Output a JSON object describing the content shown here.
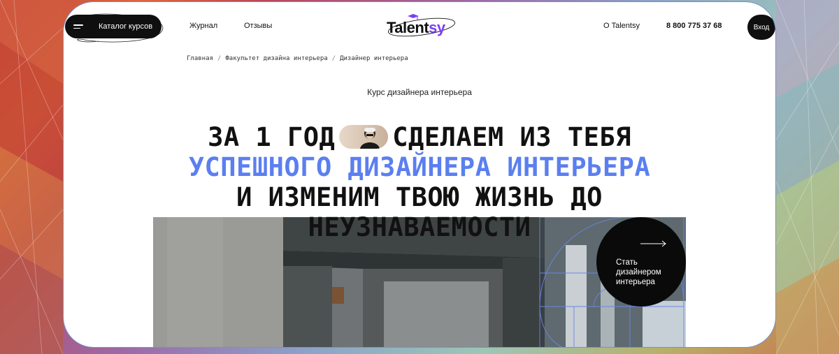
{
  "header": {
    "catalog_label": "Каталог курсов",
    "nav": [
      "Журнал",
      "Отзывы"
    ],
    "logo_main": "Talent",
    "logo_accent": "sy",
    "about_label": "О Talentsy",
    "phone": "8 800 775 37 68",
    "login_label": "Вход"
  },
  "breadcrumb": [
    "Главная",
    "Факультет дизайна интерьера",
    "Дизайнер интерьера"
  ],
  "subtitle": "Курс дизайнера интерьера",
  "hero": {
    "line1_a": "ЗА 1 ГОД",
    "line1_b": "СДЕЛАЕМ ИЗ ТЕБЯ",
    "line2": "УСПЕШНОГО ДИЗАЙНЕРА ИНТЕРЬЕРА",
    "line3": "И ИЗМЕНИМ ТВОЮ ЖИЗНЬ ДО",
    "line4": "НЕУЗНАВАЕМОСТИ"
  },
  "cta": {
    "line1": "Стать",
    "line2": "дизайнером",
    "line3": "интерьера"
  },
  "colors": {
    "accent_blue": "#5b7ff0",
    "logo_purple": "#7b3ff2",
    "button_dark": "#0f0f10"
  }
}
